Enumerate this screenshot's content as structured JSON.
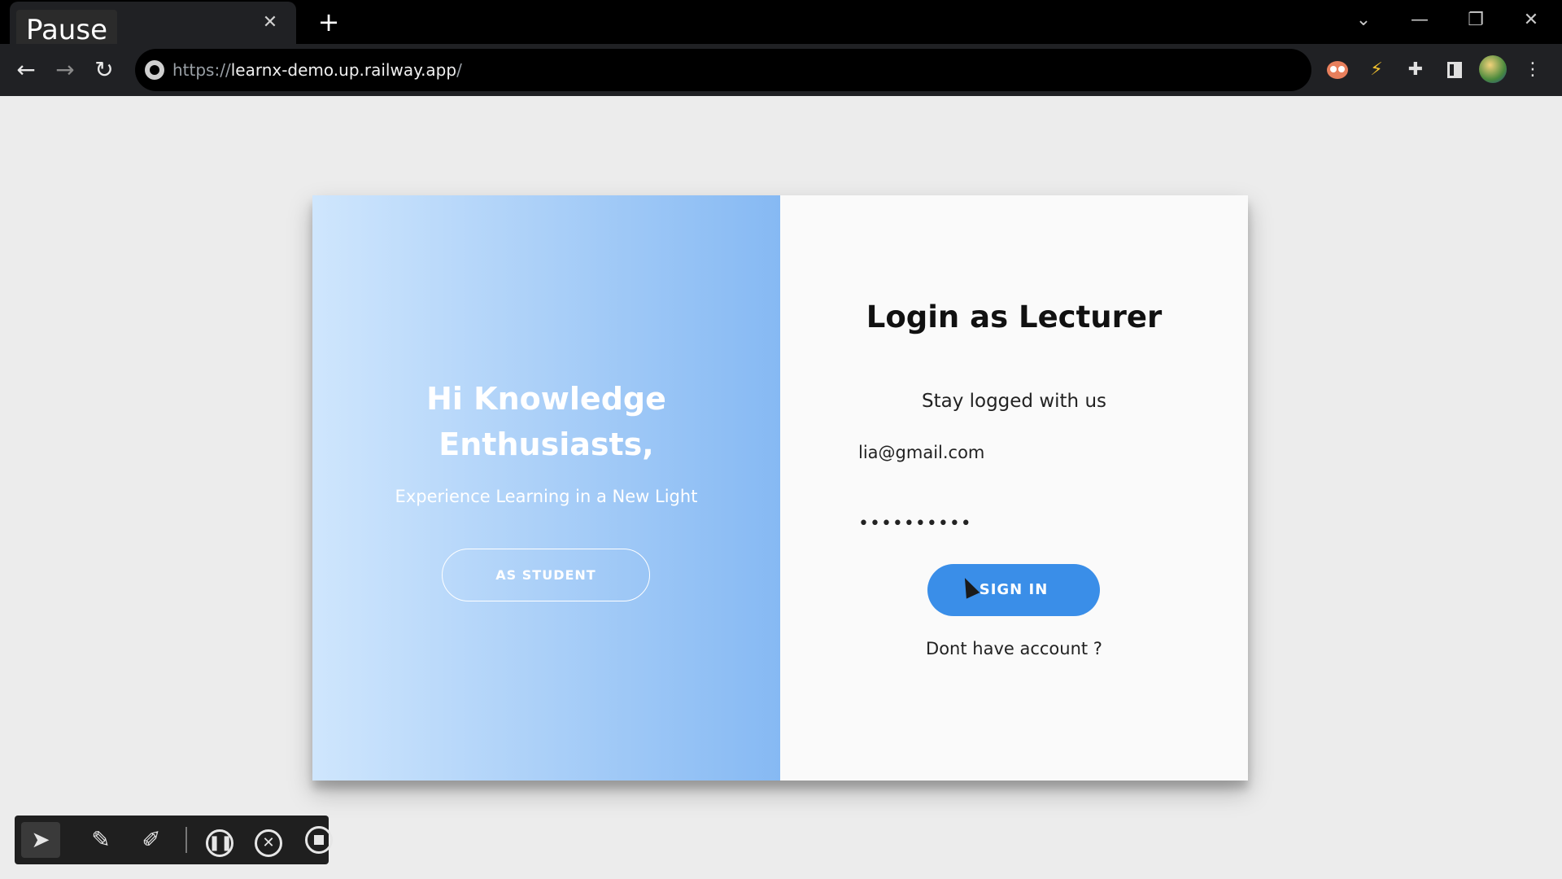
{
  "browser": {
    "tab_title": "Pause",
    "tab_close": "✕",
    "new_tab": "+",
    "url_scheme": "https://",
    "url_host": "learnx-demo.up.railway.app",
    "url_path": "/",
    "window_controls": {
      "tab_list": "⌄",
      "minimize": "—",
      "restore": "❐",
      "close": "✕"
    },
    "icons": {
      "back": "←",
      "forward": "→",
      "reload": "↻",
      "extension_lightning": "⚡",
      "extension_puzzle": "✚",
      "menu": "⋮"
    }
  },
  "left_panel": {
    "greeting_line1": "Hi Knowledge",
    "greeting_line2": "Enthusiasts,",
    "tagline": "Experience Learning in a New Light",
    "student_button": "AS STUDENT"
  },
  "right_panel": {
    "title": "Login as Lecturer",
    "subtitle": "Stay logged with us",
    "email_value": "lia@gmail.com",
    "password_value": "••••••••••",
    "signin_button": "SIGN IN",
    "account_link": "Dont have account ?"
  },
  "recorder": {
    "pointer": "➤",
    "pen": "✎",
    "highlighter": "✐",
    "pause": "❚❚",
    "cancel": "✕"
  },
  "colors": {
    "gradient_start": "#cfe6fd",
    "gradient_end": "#86b9f3",
    "signin_button": "#3a8ee8",
    "page_background": "#ececec"
  }
}
